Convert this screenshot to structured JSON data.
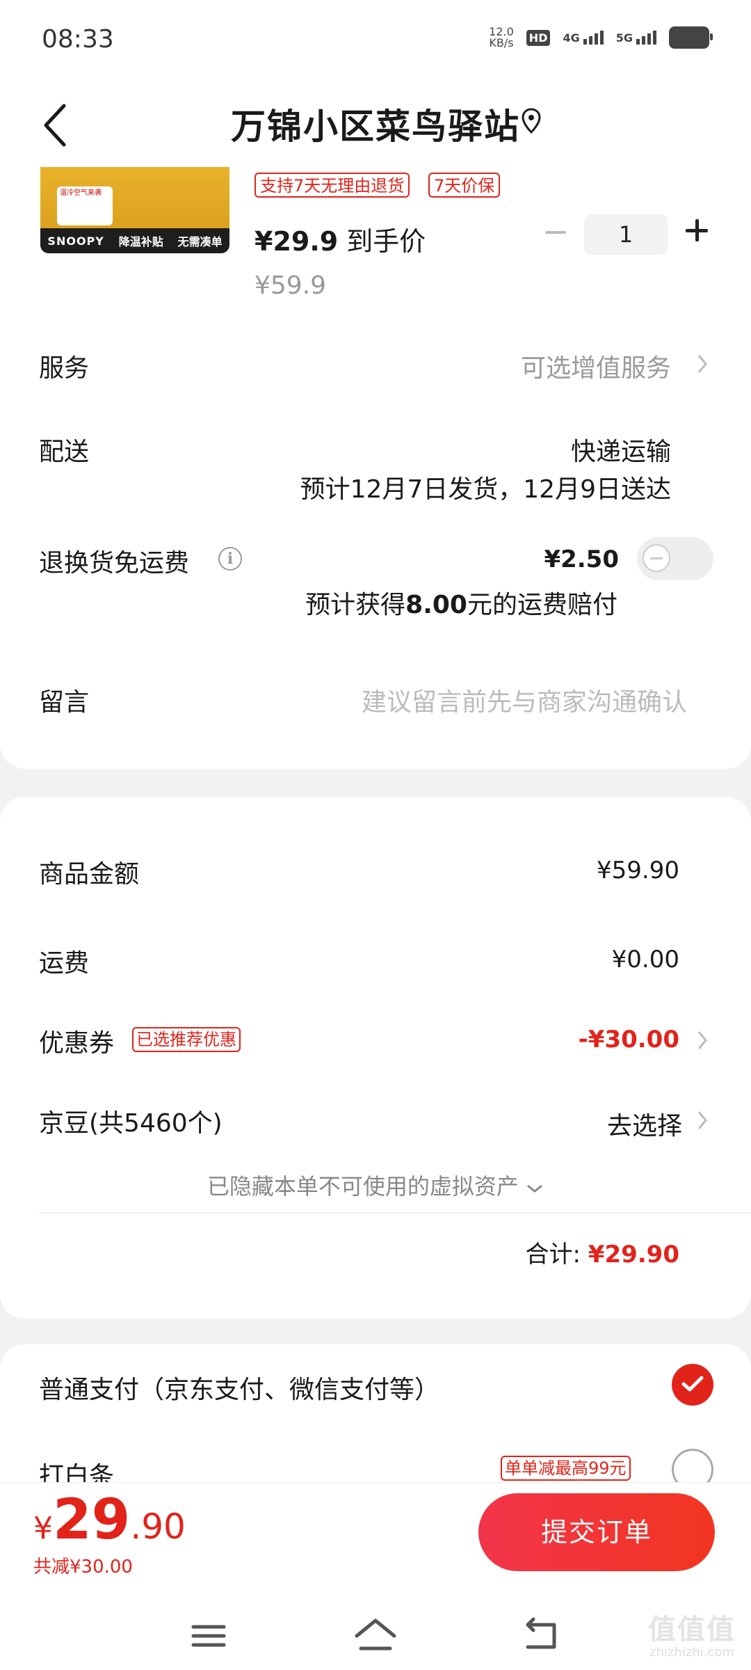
{
  "status_bar": {
    "time": "08:33",
    "net_speed_value": "12.0",
    "net_speed_unit": "KB/s",
    "hd": "HD",
    "sim1": "4G",
    "sim2": "5G"
  },
  "header": {
    "title": "万锦小区菜鸟驿站",
    "back_icon": "chevron-left-icon",
    "location_icon": "location-pin-icon"
  },
  "product": {
    "thumb_brand": "SNOOPY",
    "thumb_promo1": "降温补贴",
    "thumb_promo2": "无需凑单",
    "thumb_note": "温冷空气来袭",
    "tags": [
      "支持7天无理由退货",
      "7天价保"
    ],
    "price": "¥29.9",
    "price_suffix": "到手价",
    "original_price": "¥59.9",
    "quantity": "1"
  },
  "rows": {
    "service_label": "服务",
    "service_value": "可选增值服务",
    "delivery_label": "配送",
    "delivery_method": "快递运输",
    "delivery_estimate": "预计12月7日发货，12月9日送达",
    "return_label": "退换货免运费",
    "return_price": "¥2.50",
    "return_note_prefix": "预计获得",
    "return_note_amount": "8.00",
    "return_note_suffix": "元的运费赔付",
    "note_label": "留言",
    "note_placeholder": "建议留言前先与商家沟通确认"
  },
  "summary": {
    "goods_label": "商品金额",
    "goods_value": "¥59.90",
    "shipping_label": "运费",
    "shipping_value": "¥0.00",
    "coupon_label": "优惠券",
    "coupon_tag": "已选推荐优惠",
    "coupon_value": "-¥30.00",
    "beans_label": "京豆(共5460个)",
    "beans_value": "去选择",
    "hidden_assets": "已隐藏本单不可使用的虚拟资产",
    "total_label": "合计:",
    "total_value": "¥29.90"
  },
  "payment": {
    "normal_label": "普通支付（京东支付、微信支付等）",
    "normal_selected": true,
    "baitiao_label": "打白条",
    "baitiao_tag": "单单减最高99元",
    "baitiao_selected": false
  },
  "bottom": {
    "currency": "¥",
    "price_int": "29",
    "price_dec": ".90",
    "saved": "共减¥30.00",
    "submit": "提交订单"
  },
  "watermark": {
    "logo": "值值值",
    "site": "zhizhizhi.com"
  },
  "colors": {
    "accent": "#e2231a",
    "button_gradient_start": "#f2354a",
    "button_gradient_end": "#f23520"
  }
}
